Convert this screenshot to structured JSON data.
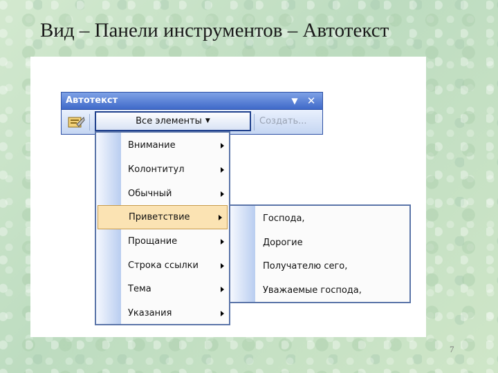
{
  "slide": {
    "title": "Вид – Панели инструментов – Автотекст",
    "page_number": "7"
  },
  "toolbar": {
    "title": "Автотекст",
    "options_icon": "dropdown-triangle-icon",
    "close_icon": "close-icon",
    "all_entries_label": "Все элементы",
    "create_label": "Создать..."
  },
  "menu": {
    "items": [
      {
        "label": "Внимание"
      },
      {
        "label": "Колонтитул"
      },
      {
        "label": "Обычный"
      },
      {
        "label": "Приветствие",
        "highlighted": true
      },
      {
        "label": "Прощание"
      },
      {
        "label": "Строка ссылки"
      },
      {
        "label": "Тема"
      },
      {
        "label": "Указания"
      }
    ]
  },
  "submenu": {
    "items": [
      {
        "label": "Господа,"
      },
      {
        "label": "Дорогие"
      },
      {
        "label": "Получателю сего,"
      },
      {
        "label": "Уважаемые господа,"
      }
    ]
  },
  "colors": {
    "title_bar": "#3f69c9",
    "highlight": "#fbe3b3",
    "menu_border": "#5a74a8"
  }
}
